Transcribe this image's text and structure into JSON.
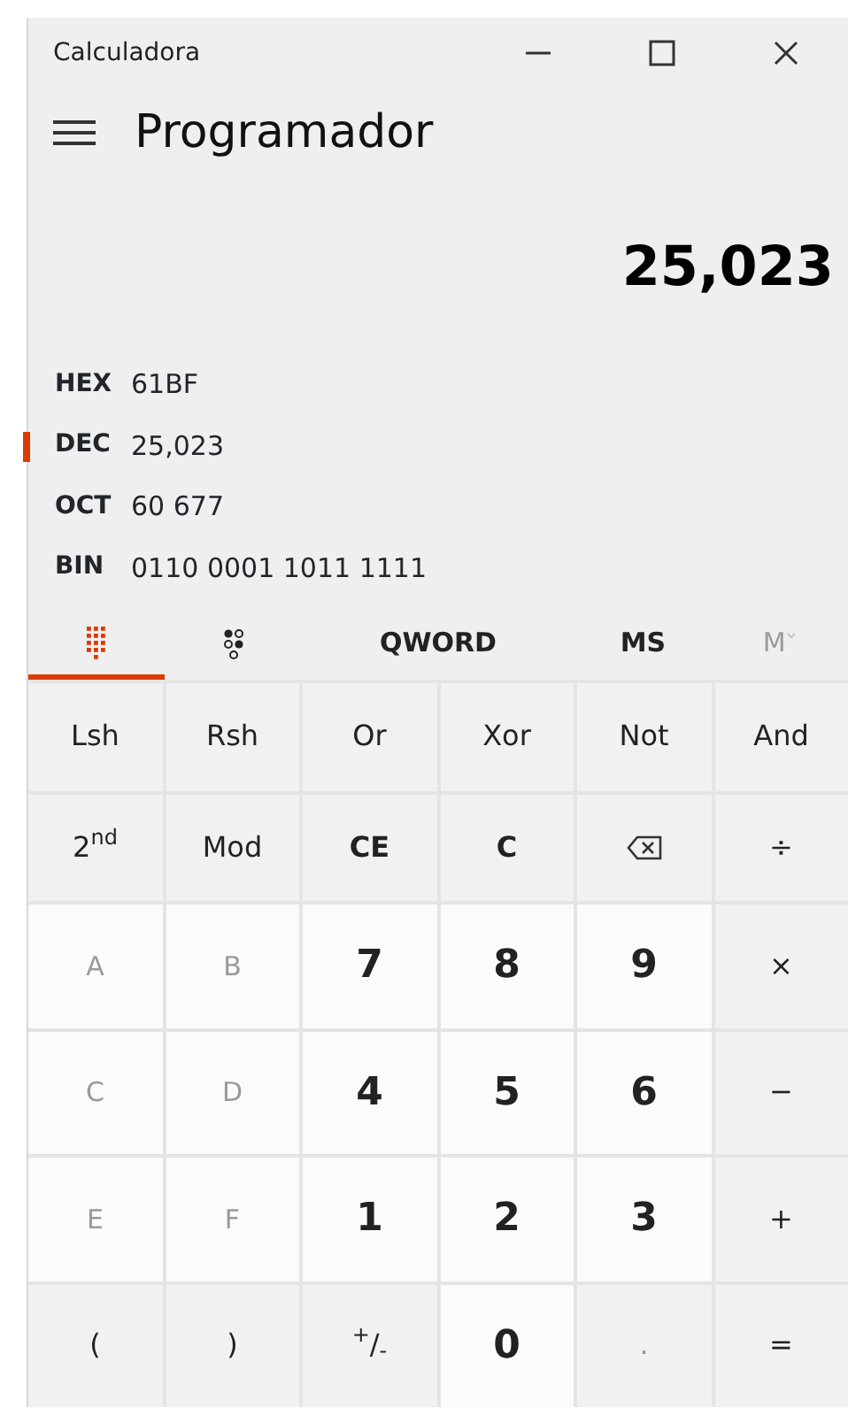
{
  "window": {
    "title": "Calculadora"
  },
  "header": {
    "mode": "Programador"
  },
  "display": "25,023",
  "radix": [
    {
      "label": "HEX",
      "value": "61BF",
      "selected": false
    },
    {
      "label": "DEC",
      "value": "25,023",
      "selected": true
    },
    {
      "label": "OCT",
      "value": "60 677",
      "selected": false
    },
    {
      "label": "BIN",
      "value": "0110 0001 1011 1111",
      "selected": false
    }
  ],
  "toolbar": [
    {
      "kind": "keypad",
      "selected": true
    },
    {
      "kind": "bits",
      "selected": false
    },
    {
      "kind": "word",
      "label": "QWORD"
    },
    {
      "kind": "memory",
      "label": "MS",
      "disabled": false
    },
    {
      "kind": "memory-list",
      "label": "M",
      "disabled": true
    }
  ],
  "keys": [
    {
      "label": "Lsh",
      "kind": "op",
      "disabled": false
    },
    {
      "label": "Rsh",
      "kind": "op",
      "disabled": false
    },
    {
      "label": "Or",
      "kind": "op",
      "disabled": false
    },
    {
      "label": "Xor",
      "kind": "op",
      "disabled": false
    },
    {
      "label": "Not",
      "kind": "op",
      "disabled": false
    },
    {
      "label": "And",
      "kind": "op",
      "disabled": false
    },
    {
      "label": "2$^{nd}$",
      "kind": "op",
      "disabled": false
    },
    {
      "label": "Mod",
      "kind": "op",
      "disabled": false
    },
    {
      "label": "CE",
      "kind": "op-bold",
      "disabled": false
    },
    {
      "label": "C",
      "kind": "op-bold",
      "disabled": false
    },
    {
      "kind": "backspace",
      "disabled": false
    },
    {
      "label": "÷",
      "kind": "op",
      "disabled": false
    },
    {
      "label": "A",
      "kind": "digit",
      "disabled": true
    },
    {
      "label": "B",
      "kind": "digit",
      "disabled": true
    },
    {
      "label": "7",
      "kind": "digit",
      "disabled": false
    },
    {
      "label": "8",
      "kind": "digit",
      "disabled": false
    },
    {
      "label": "9",
      "kind": "digit",
      "disabled": false
    },
    {
      "label": "×",
      "kind": "op",
      "disabled": false
    },
    {
      "label": "C",
      "kind": "digit",
      "disabled": true
    },
    {
      "label": "D",
      "kind": "digit",
      "disabled": true
    },
    {
      "label": "4",
      "kind": "digit",
      "disabled": false
    },
    {
      "label": "5",
      "kind": "digit",
      "disabled": false
    },
    {
      "label": "6",
      "kind": "digit",
      "disabled": false
    },
    {
      "label": "−",
      "kind": "op",
      "disabled": false
    },
    {
      "label": "E",
      "kind": "digit",
      "disabled": true
    },
    {
      "label": "F",
      "kind": "digit",
      "disabled": true
    },
    {
      "label": "1",
      "kind": "digit",
      "disabled": false
    },
    {
      "label": "2",
      "kind": "digit",
      "disabled": false
    },
    {
      "label": "3",
      "kind": "digit",
      "disabled": false
    },
    {
      "label": "+",
      "kind": "op",
      "disabled": false
    },
    {
      "label": "(",
      "kind": "op",
      "disabled": false
    },
    {
      "label": ")",
      "kind": "op",
      "disabled": false
    },
    {
      "label": "$^{+}$/$_{-}$",
      "kind": "op",
      "disabled": false
    },
    {
      "label": "0",
      "kind": "digit",
      "disabled": false
    },
    {
      "label": ".",
      "kind": "op",
      "disabled": true
    },
    {
      "label": "=",
      "kind": "op",
      "disabled": false
    }
  ]
}
